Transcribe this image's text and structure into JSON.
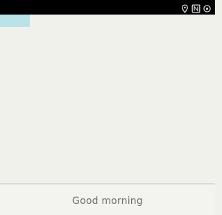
{
  "status_bar": {
    "icons": [
      "location-icon",
      "nfc-icon",
      "sync-icon"
    ],
    "background": "#000000",
    "icon_color": "#d8d8d8"
  },
  "tab": {
    "color": "#b9e3e6"
  },
  "footer": {
    "greeting": "Good morning"
  },
  "colors": {
    "background": "#f1f1ec",
    "text": "#6d6d6d"
  }
}
